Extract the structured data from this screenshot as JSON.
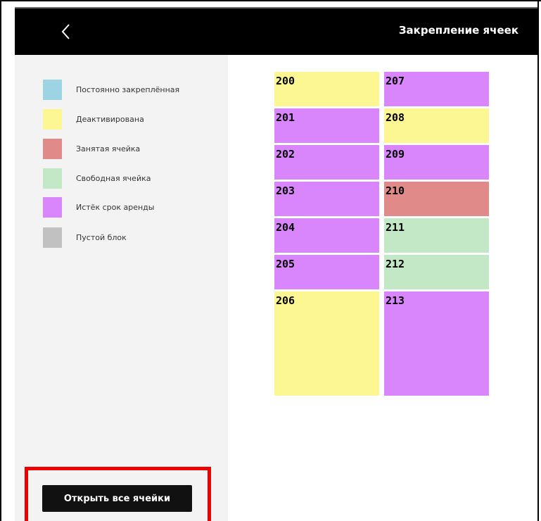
{
  "header": {
    "back_icon": "chevron-left-icon",
    "title": "Закрепление ячеек"
  },
  "legend": [
    {
      "label": "Постоянно закреплённая",
      "color": "#9dd4e3"
    },
    {
      "label": "Деактивирована",
      "color": "#fdf793"
    },
    {
      "label": "Занятая ячейка",
      "color": "#e08a8a"
    },
    {
      "label": "Свободная ячейка",
      "color": "#c3e8c5"
    },
    {
      "label": "Истёк срок аренды",
      "color": "#d985fb"
    },
    {
      "label": "Пустой блок",
      "color": "#c1c1c1"
    }
  ],
  "cells": [
    {
      "number": "200",
      "color": "#fdf793"
    },
    {
      "number": "201",
      "color": "#d985fb"
    },
    {
      "number": "202",
      "color": "#d985fb"
    },
    {
      "number": "203",
      "color": "#d985fb"
    },
    {
      "number": "204",
      "color": "#d985fb"
    },
    {
      "number": "205",
      "color": "#d985fb"
    },
    {
      "number": "206",
      "color": "#fdf793"
    },
    {
      "number": "207",
      "color": "#d985fb"
    },
    {
      "number": "208",
      "color": "#fdf793"
    },
    {
      "number": "209",
      "color": "#d985fb"
    },
    {
      "number": "210",
      "color": "#e08a8a"
    },
    {
      "number": "211",
      "color": "#c3e8c5"
    },
    {
      "number": "212",
      "color": "#c3e8c5"
    },
    {
      "number": "213",
      "color": "#d985fb"
    }
  ],
  "actions": {
    "open_all_label": "Открыть все ячейки"
  }
}
